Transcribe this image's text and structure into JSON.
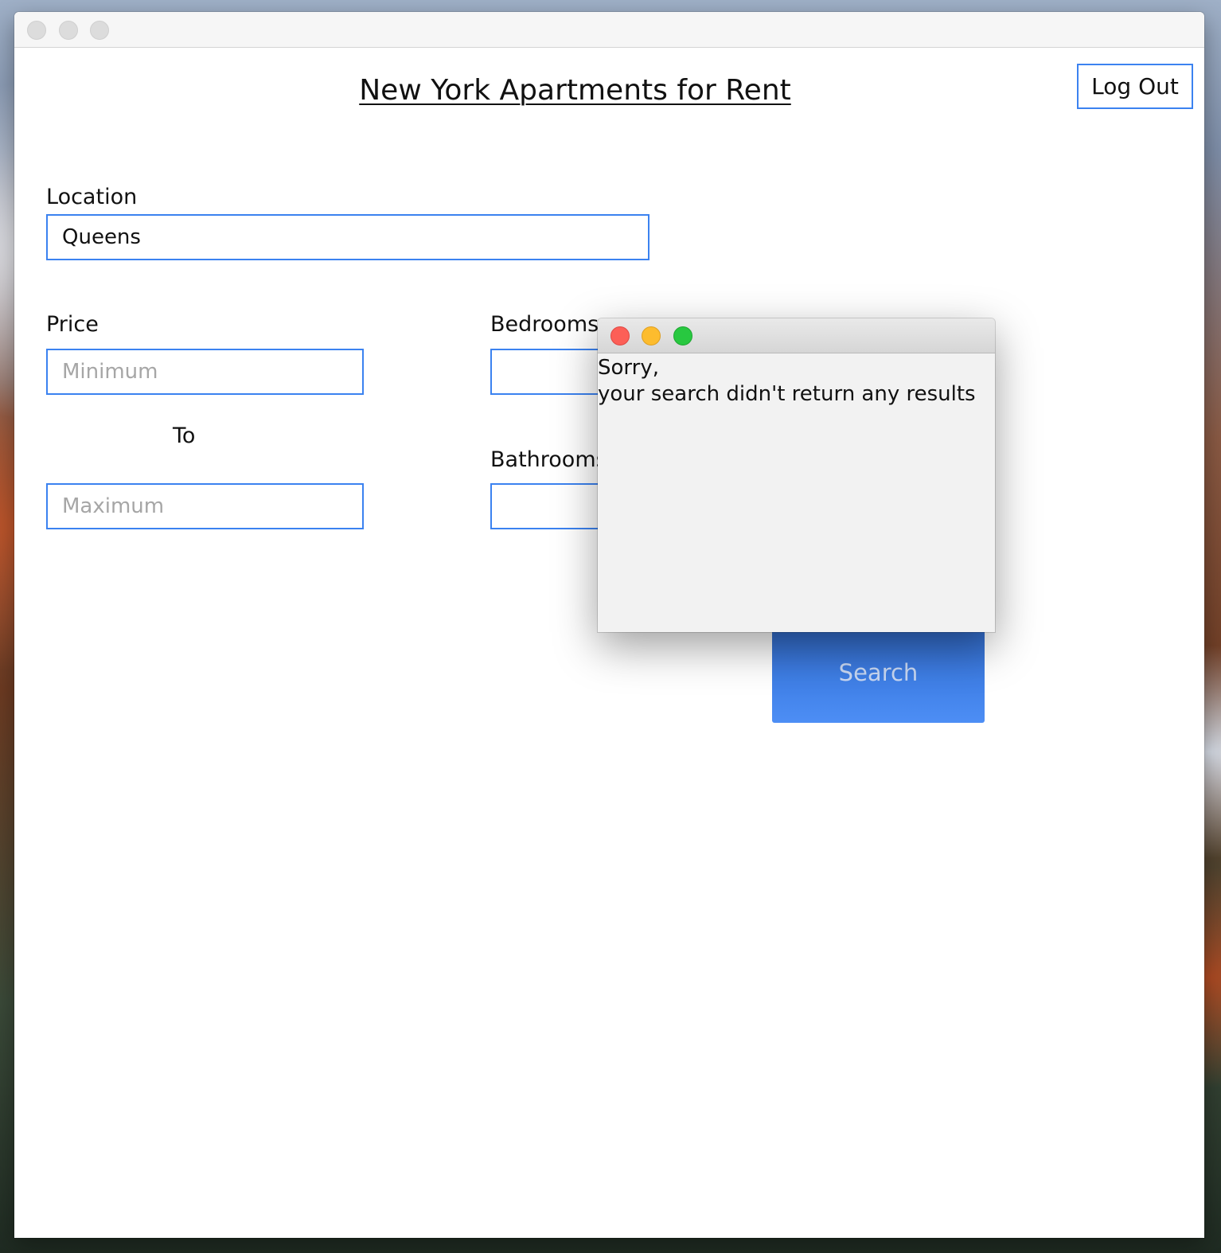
{
  "page": {
    "title": "New York Apartments for Rent",
    "logout_label": "Log Out"
  },
  "form": {
    "location_label": "Location",
    "location_value": "Queens",
    "price_label": "Price",
    "price_min_placeholder": "Minimum",
    "price_to_label": "To",
    "price_max_placeholder": "Maximum",
    "bedrooms_label": "Bedrooms",
    "bathrooms_label": "Bathrooms",
    "search_label": "Search"
  },
  "dialog": {
    "line1": "Sorry,",
    "line2": "your search didn't return any results"
  },
  "colors": {
    "accent": "#3b82f0",
    "button": "#3f7fe6",
    "close": "#fc5f57",
    "minimize": "#fdbc2e",
    "zoom": "#28c840"
  }
}
